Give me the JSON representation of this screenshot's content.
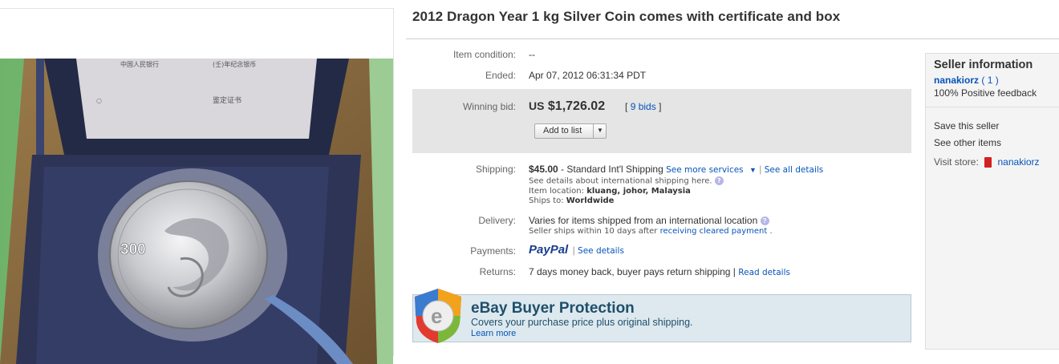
{
  "listing": {
    "title": "2012 Dragon Year 1 kg Silver Coin comes with certificate and box",
    "coin_denomination": "300"
  },
  "details": {
    "condition_label": "Item condition:",
    "condition_value": "--",
    "ended_label": "Ended:",
    "ended_value": "Apr 07, 2012 06:31:34 PDT",
    "winning_bid_label": "Winning bid:",
    "currency": "US",
    "price": "$1,726.02",
    "bids_open": "[",
    "bids_link": "9 bids",
    "bids_close": "]",
    "add_to_list": "Add to list",
    "shipping_label": "Shipping:",
    "shipping_cost": "$45.00",
    "shipping_method": "- Standard Int'l Shipping",
    "see_more_services": "See more services",
    "see_all_details": "See all details",
    "shipping_note": "See details about international shipping here.",
    "item_location_label": "Item location:",
    "item_location": "kluang, johor, Malaysia",
    "ships_to_label": "Ships to:",
    "ships_to": "Worldwide",
    "delivery_label": "Delivery:",
    "delivery_value": "Varies for items shipped from an international location",
    "delivery_note": "Seller ships within 10 days after",
    "delivery_link": "receiving cleared payment",
    "delivery_end": ".",
    "payments_label": "Payments:",
    "paypal": "PayPal",
    "payments_details": "See details",
    "returns_label": "Returns:",
    "returns_value": "7 days money back, buyer pays return shipping |",
    "returns_details": "Read details"
  },
  "buyer_protection": {
    "title": "eBay Buyer Protection",
    "subtitle": "Covers your purchase price plus original shipping.",
    "learn_more": "Learn more",
    "badge_letter": "e"
  },
  "seller": {
    "heading": "Seller information",
    "username": "nanakiorz",
    "feedback_score": "( 1 )",
    "positive_feedback": "100% Positive feedback",
    "save_seller": "Save this seller",
    "other_items": "See other items",
    "visit_store_label": "Visit store:",
    "store_name": "nanakiorz"
  },
  "colors": {
    "link": "#0654ba",
    "bid_box": "#e5e5e5",
    "protection_bg": "#dde9ee"
  }
}
